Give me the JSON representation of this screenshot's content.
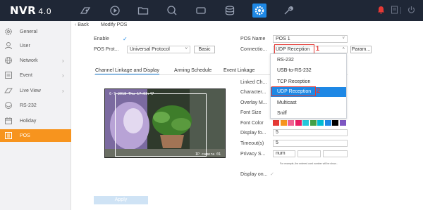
{
  "topbar": {
    "brand": "NVR",
    "version": "4.0",
    "icons": [
      "live-view-icon",
      "playback-icon",
      "file-icon",
      "search-icon",
      "ptz-icon",
      "storage-icon",
      "settings-icon",
      "maintenance-icon",
      "alarm-icon",
      "account-icon",
      "power-icon"
    ],
    "active_icon": "settings-icon",
    "bg_color": "#1f2736",
    "accent_color": "#1e88e5"
  },
  "sidebar": {
    "items": [
      {
        "label": "General",
        "icon": "gear-icon",
        "arrow": false
      },
      {
        "label": "User",
        "icon": "user-icon",
        "arrow": false
      },
      {
        "label": "Network",
        "icon": "network-icon",
        "arrow": true
      },
      {
        "label": "Event",
        "icon": "event-icon",
        "arrow": true
      },
      {
        "label": "Live View",
        "icon": "live-view-icon",
        "arrow": true
      },
      {
        "label": "RS-232",
        "icon": "rs232-icon",
        "arrow": false
      },
      {
        "label": "Holiday",
        "icon": "calendar-icon",
        "arrow": false
      },
      {
        "label": "POS",
        "icon": "pos-icon",
        "arrow": false
      }
    ],
    "active": "POS",
    "active_color": "#f7941e"
  },
  "header": {
    "back_label": "Back",
    "title": "Modify POS"
  },
  "form": {
    "enable_label": "Enable",
    "enable_checked": true,
    "pos_protocol_label": "POS Prot...",
    "pos_protocol_value": "Universal Protocol",
    "basic_button": "Basic",
    "pos_name_label": "POS Name",
    "pos_name_value": "POS 1",
    "connection_label": "Connectio...",
    "connection_value": "UDP Reception",
    "param_button": "Param..."
  },
  "tabs": [
    "Channel Linkage and Display",
    "Arming Schedule",
    "Event Linkage"
  ],
  "active_tab": "Channel Linkage and Display",
  "preview": {
    "osd_time": "6-7-2018 Thu 17:03:47",
    "osd_camera": "IP camera 01"
  },
  "fields": {
    "linked_channel_label": "Linked Ch...",
    "character_label": "Character...",
    "overlay_mode_label": "Overlay M...",
    "font_size_label": "Font Size",
    "font_color_label": "Font Color",
    "display_for_label": "Display fo...",
    "display_for_value": "5",
    "timeout_label": "Timeout(s)",
    "timeout_value": "5",
    "privacy_label": "Privacy S...",
    "privacy_value": "num",
    "privacy_hint": "For example, the entered card number will be show...",
    "display_on_label": "Display on..."
  },
  "font_colors": [
    "#e53935",
    "#f7941e",
    "#f06292",
    "#e91e63",
    "#26c6da",
    "#43a047",
    "#00bcd4",
    "#1e88e5",
    "#000000",
    "#7e57c2"
  ],
  "dropdown": {
    "options": [
      "RS-232",
      "USB-to-RS-232",
      "TCP Reception",
      "UDP Reception",
      "Multicast",
      "Sniff"
    ],
    "selected": "UDP Reception"
  },
  "annotations": {
    "mark1": "1",
    "mark2": "2",
    "color": "#e53935"
  },
  "apply_button": "Apply"
}
